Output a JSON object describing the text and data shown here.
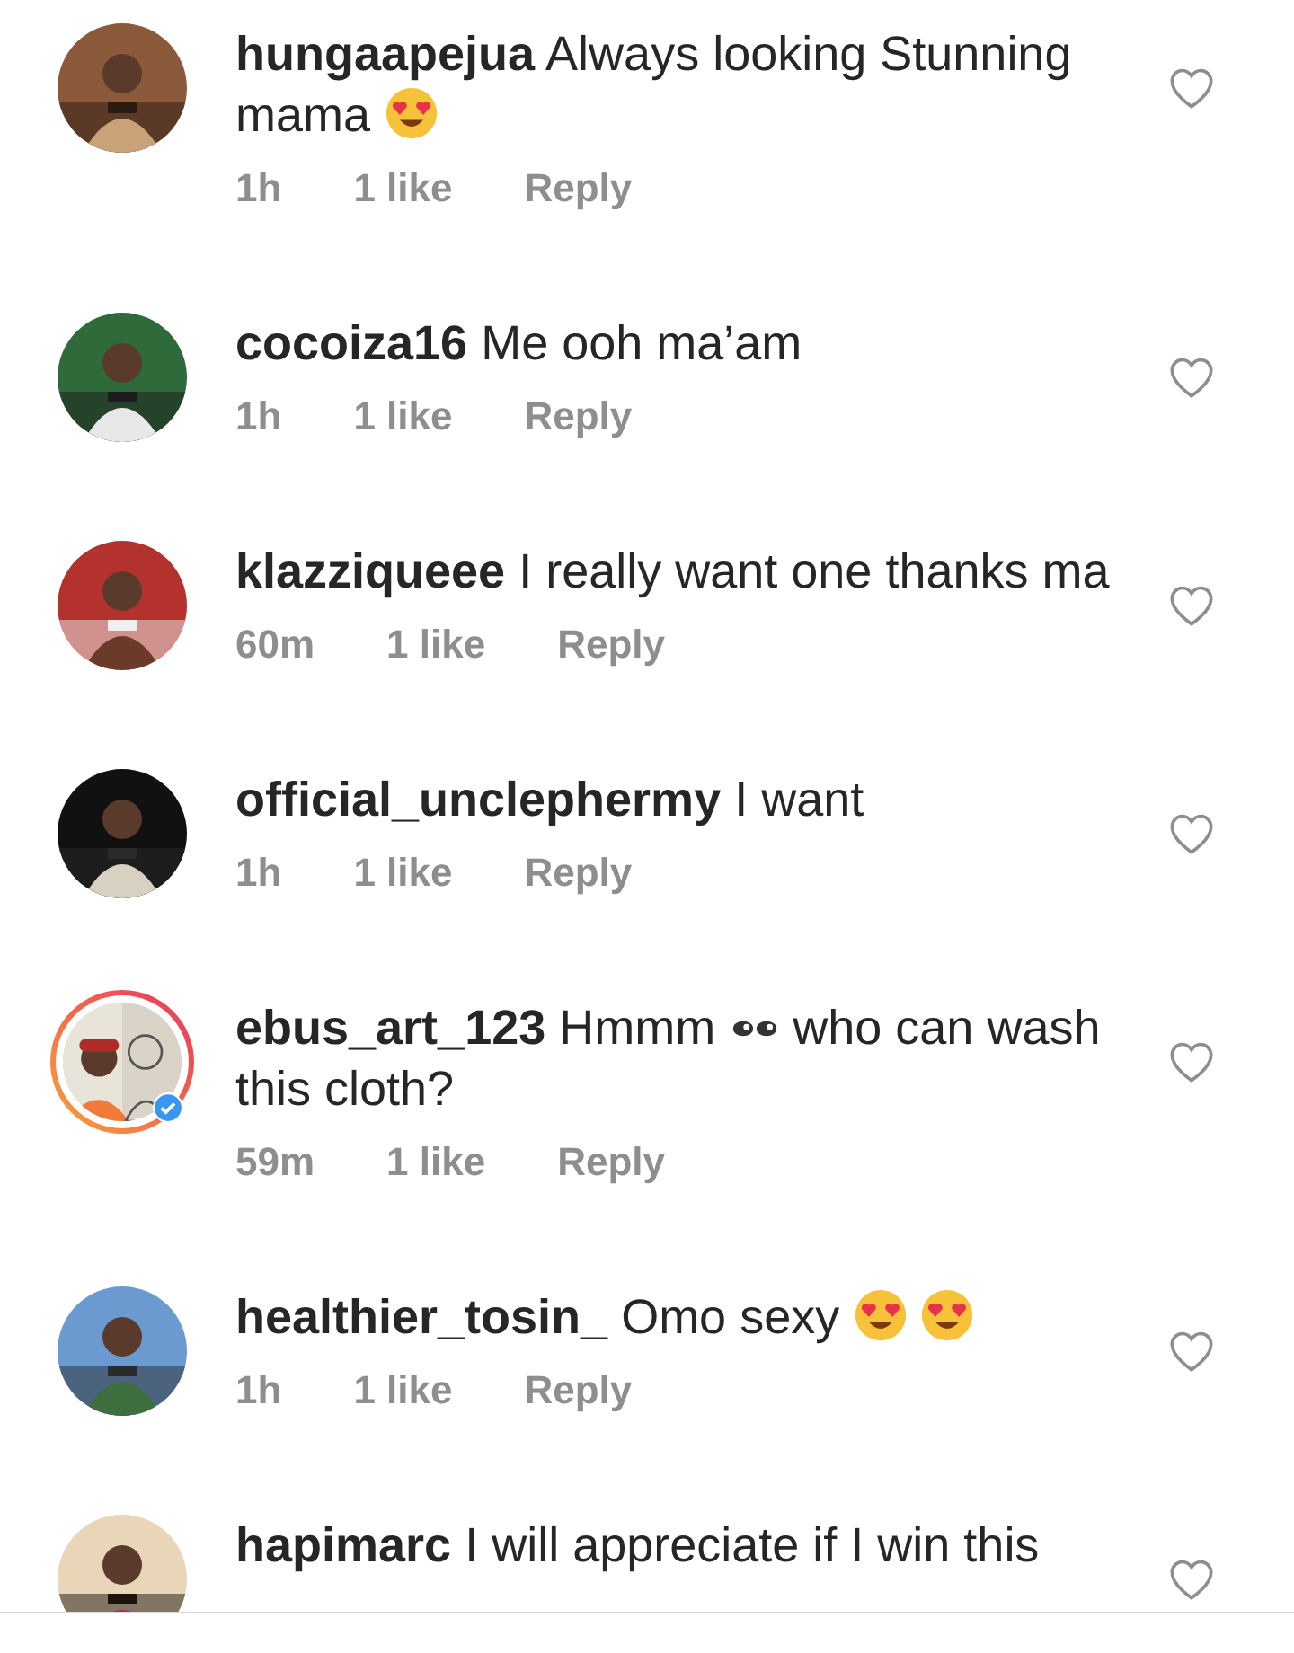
{
  "comments": [
    {
      "username": "hungaapejua",
      "avatar": {
        "story_ring": false
      },
      "body": [
        {
          "kind": "text",
          "text": "Always looking Stunning mama"
        },
        {
          "kind": "heart_eyes"
        }
      ],
      "time": "1h",
      "likes": "1 like",
      "reply": "Reply",
      "liked": false
    },
    {
      "username": "cocoiza16",
      "avatar": {
        "story_ring": false
      },
      "body": [
        {
          "kind": "text",
          "text": "Me ooh ma’am"
        }
      ],
      "time": "1h",
      "likes": "1 like",
      "reply": "Reply",
      "liked": false
    },
    {
      "username": "klazziqueee",
      "avatar": {
        "story_ring": false
      },
      "body": [
        {
          "kind": "text",
          "text": "I really want one thanks ma"
        }
      ],
      "time": "60m",
      "likes": "1 like",
      "reply": "Reply",
      "liked": false
    },
    {
      "username": "official_unclephermy",
      "avatar": {
        "story_ring": false
      },
      "body": [
        {
          "kind": "text",
          "text": "I want"
        }
      ],
      "time": "1h",
      "likes": "1 like",
      "reply": "Reply",
      "liked": false
    },
    {
      "username": "ebus_art_123",
      "avatar": {
        "story_ring": true,
        "verified": true
      },
      "body": [
        {
          "kind": "text",
          "text": "Hmmm"
        },
        {
          "kind": "eyes"
        },
        {
          "kind": "text",
          "text": "who can wash this cloth?"
        }
      ],
      "time": "59m",
      "likes": "1 like",
      "reply": "Reply",
      "liked": false
    },
    {
      "username": "healthier_tosin_",
      "avatar": {
        "story_ring": false
      },
      "body": [
        {
          "kind": "text",
          "text": "Omo sexy"
        },
        {
          "kind": "heart_eyes"
        },
        {
          "kind": "heart_eyes"
        }
      ],
      "time": "1h",
      "likes": "1 like",
      "reply": "Reply",
      "liked": false
    },
    {
      "username": "hapimarc",
      "avatar": {
        "story_ring": false
      },
      "body": [
        {
          "kind": "text",
          "text": "I will appreciate if I win this"
        }
      ],
      "liked": false
    }
  ]
}
